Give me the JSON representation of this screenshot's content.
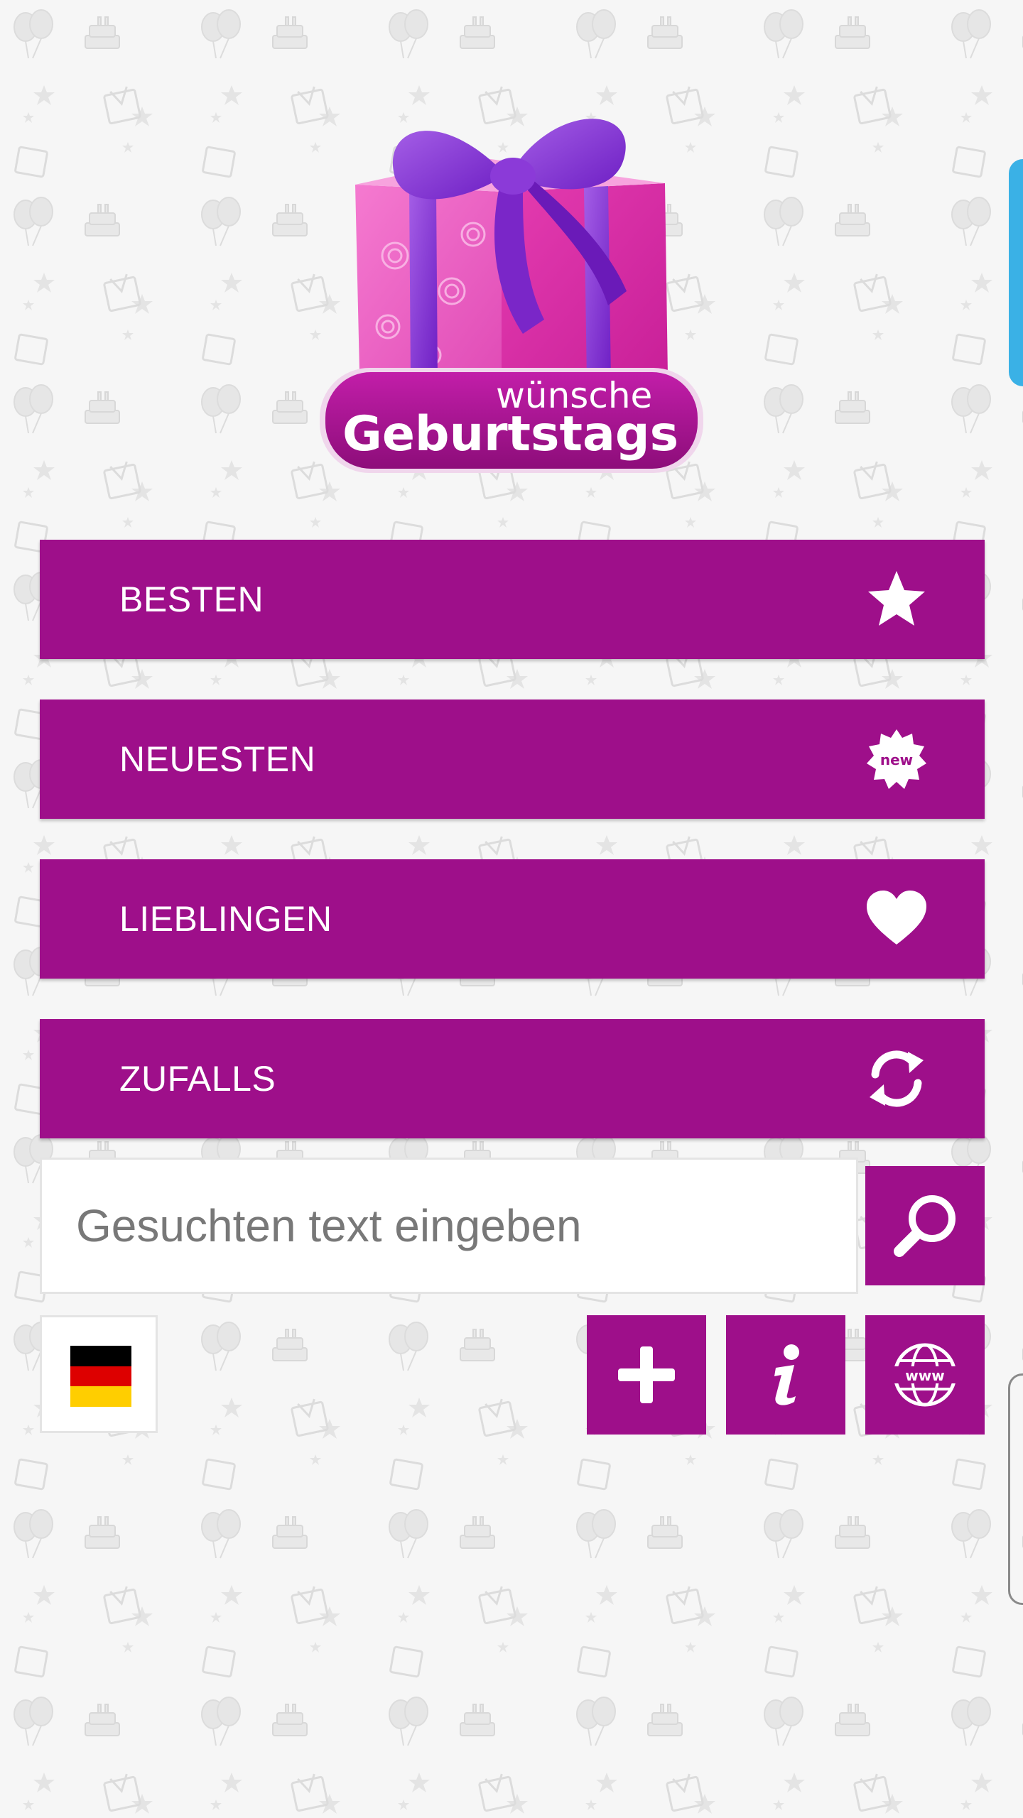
{
  "logo": {
    "line1": "wünsche",
    "line2": "Geburtstags"
  },
  "menu": [
    {
      "label": "BESTEN",
      "icon": "star-icon"
    },
    {
      "label": "NEUESTEN",
      "icon": "new-badge-icon",
      "badge_text": "new"
    },
    {
      "label": "LIEBLINGEN",
      "icon": "heart-icon"
    },
    {
      "label": "ZUFALLS",
      "icon": "refresh-icon"
    }
  ],
  "search": {
    "placeholder": "Gesuchten text eingeben",
    "value": ""
  },
  "actions": {
    "www_text": "www"
  },
  "colors": {
    "primary": "#9e0f8a",
    "background": "#f6f6f6",
    "edge_accent": "#3ab1e6"
  }
}
